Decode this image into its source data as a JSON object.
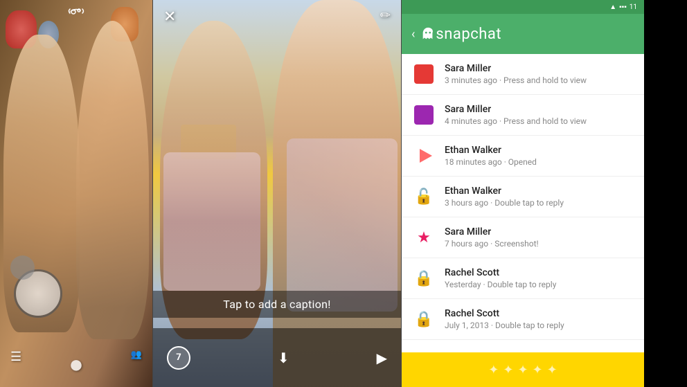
{
  "panels": {
    "left": {
      "camera_icon": "📷",
      "bottom_icons": [
        "☰",
        "●"
      ]
    },
    "middle": {
      "close_icon": "✕",
      "pencil_icon": "✏",
      "caption": "Tap to add a caption!",
      "timer": "7",
      "bottom_icons": [
        "↓",
        "▶"
      ]
    },
    "right": {
      "header": {
        "title": "snapchat",
        "back_arrow": "‹"
      },
      "status_bar": {
        "icons": "▲ ▪ ▪ ▪ 11"
      },
      "snaps": [
        {
          "id": 1,
          "name": "Sara Miller",
          "time": "3 minutes ago · Press and hold to view",
          "icon_type": "red-box"
        },
        {
          "id": 2,
          "name": "Sara Miller",
          "time": "4 minutes ago · Press and hold to view",
          "icon_type": "purple-box"
        },
        {
          "id": 3,
          "name": "Ethan Walker",
          "time": "18 minutes ago · Opened",
          "icon_type": "arrow-right"
        },
        {
          "id": 4,
          "name": "Ethan Walker",
          "time": "3 hours ago · Double tap to reply",
          "icon_type": "lock-open"
        },
        {
          "id": 5,
          "name": "Sara Miller",
          "time": "7 hours ago · Screenshot!",
          "icon_type": "star"
        },
        {
          "id": 6,
          "name": "Rachel Scott",
          "time": "Yesterday · Double tap to reply",
          "icon_type": "lock-closed"
        },
        {
          "id": 7,
          "name": "Rachel Scott",
          "time": "July 1, 2013 · Double tap to reply",
          "icon_type": "lock-closed"
        }
      ],
      "footer_sparkles": [
        "✦",
        "✦",
        "✦",
        "✦",
        "✦"
      ]
    }
  }
}
